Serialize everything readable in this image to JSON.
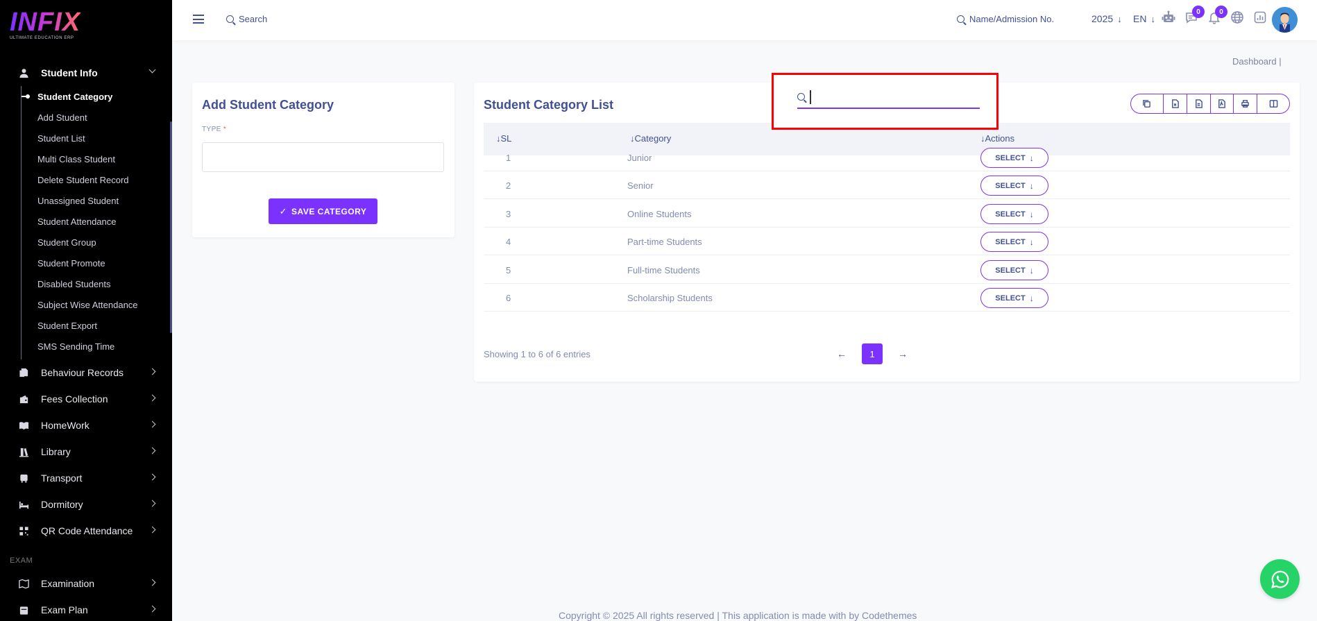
{
  "brand": {
    "name": "INFIX",
    "tagline": "ULTIMATE EDUCATION ERP"
  },
  "sidebar": {
    "student_info": {
      "label": "Student Info",
      "icon": "user-icon"
    },
    "sub_items": [
      "Student Category",
      "Add Student",
      "Student List",
      "Multi Class Student",
      "Delete Student Record",
      "Unassigned Student",
      "Student Attendance",
      "Student Group",
      "Student Promote",
      "Disabled Students",
      "Subject Wise Attendance",
      "Student Export",
      "SMS Sending Time"
    ],
    "active_sub": "Student Category",
    "menus": [
      {
        "label": "Behaviour Records",
        "icon": "files-icon"
      },
      {
        "label": "Fees Collection",
        "icon": "wallet-icon"
      },
      {
        "label": "HomeWork",
        "icon": "book-icon"
      },
      {
        "label": "Library",
        "icon": "library-icon"
      },
      {
        "label": "Transport",
        "icon": "bus-icon"
      },
      {
        "label": "Dormitory",
        "icon": "bed-icon"
      },
      {
        "label": "QR Code Attendance",
        "icon": "qr-icon"
      }
    ],
    "section_exam": "EXAM",
    "exam_menus": [
      {
        "label": "Examination",
        "icon": "map-icon"
      },
      {
        "label": "Exam Plan",
        "icon": "calendar-icon"
      }
    ]
  },
  "header": {
    "search_label": "Search",
    "admission_search": "Name/Admission No.",
    "year": "2025",
    "language": "EN",
    "chat_badge": "0",
    "notification_badge": "0"
  },
  "breadcrumb": "Dashboard   |",
  "add_form": {
    "title": "Add Student Category",
    "type_label": "TYPE",
    "required_mark": "*",
    "type_value": "",
    "save_label": "SAVE CATEGORY"
  },
  "list": {
    "title": "Student Category List",
    "search_value": "",
    "columns": [
      "SL",
      "Category",
      "Actions"
    ],
    "rows": [
      {
        "sl": "1",
        "category": "Junior",
        "action": "SELECT"
      },
      {
        "sl": "2",
        "category": "Senior",
        "action": "SELECT"
      },
      {
        "sl": "3",
        "category": "Online Students",
        "action": "SELECT"
      },
      {
        "sl": "4",
        "category": "Part-time Students",
        "action": "SELECT"
      },
      {
        "sl": "5",
        "category": "Full-time Students",
        "action": "SELECT"
      },
      {
        "sl": "6",
        "category": "Scholarship Students",
        "action": "SELECT"
      }
    ],
    "showing": "Showing 1 to 6 of 6 entries",
    "current_page": "1"
  },
  "footer": "Copyright © 2025 All rights reserved | This application is made with by Codethemes",
  "colors": {
    "accent": "#7c32ff",
    "text": "#415094",
    "muted": "#828bb2",
    "whatsapp": "#25d366",
    "highlight": "#ff0000"
  }
}
